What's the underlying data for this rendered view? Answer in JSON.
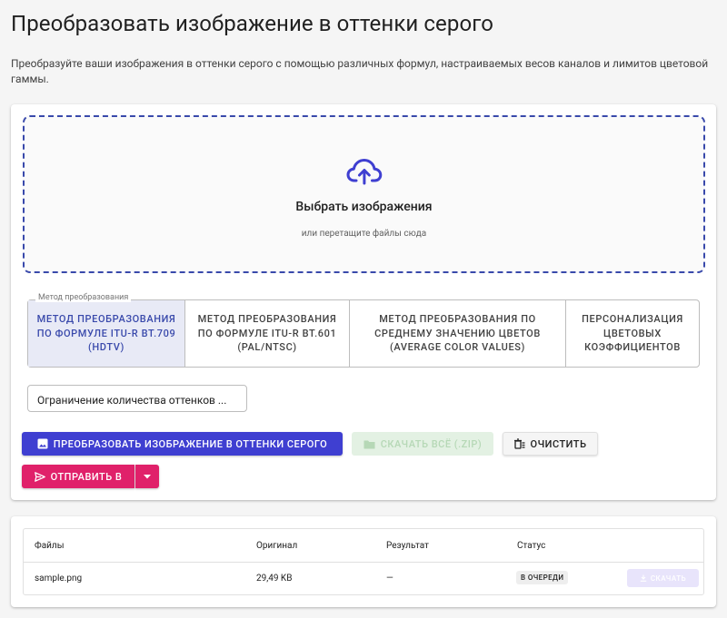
{
  "header": {
    "title": "Преобразовать изображение в оттенки серого",
    "description": "Преобразуйте ваши изображения в оттенки серого с помощью различных формул, настраиваемых весов каналов и лимитов цветовой гаммы."
  },
  "dropzone": {
    "title": "Выбрать изображения",
    "hint": "или перетащите файлы сюда",
    "icon": "cloud-upload-icon"
  },
  "method": {
    "legend": "Метод преобразования",
    "options": [
      {
        "label": "Метод преобразования по формуле ITU-R BT.709 (HDTV)",
        "active": true
      },
      {
        "label": "Метод преобразования по формуле ITU-R BT.601 (PAL/NTSC)",
        "active": false
      },
      {
        "label": "Метод преобразования по среднему значению цветов (Average Color Values)",
        "active": false
      },
      {
        "label": "Персонализация цветовых коэффициентов",
        "active": false
      }
    ]
  },
  "limit_field": {
    "value": "Ограничение количества оттенков ..."
  },
  "actions": {
    "convert_label": "Преобразовать изображение в оттенки серого",
    "zip_label": "Скачать всё (.zip)",
    "clear_label": "Очистить",
    "send_label": "Отправить в"
  },
  "files": {
    "columns": [
      "Файлы",
      "Оригинал",
      "Результат",
      "Статус"
    ],
    "rows": [
      {
        "name": "sample.png",
        "original": "29,49 KB",
        "result": "—",
        "status": "В ОЧЕРЕДИ",
        "download_label": "Скачать"
      }
    ]
  },
  "colors": {
    "primary": "#3f3fd1",
    "accent": "#e0216a",
    "dropzone_border": "#3949ab"
  }
}
